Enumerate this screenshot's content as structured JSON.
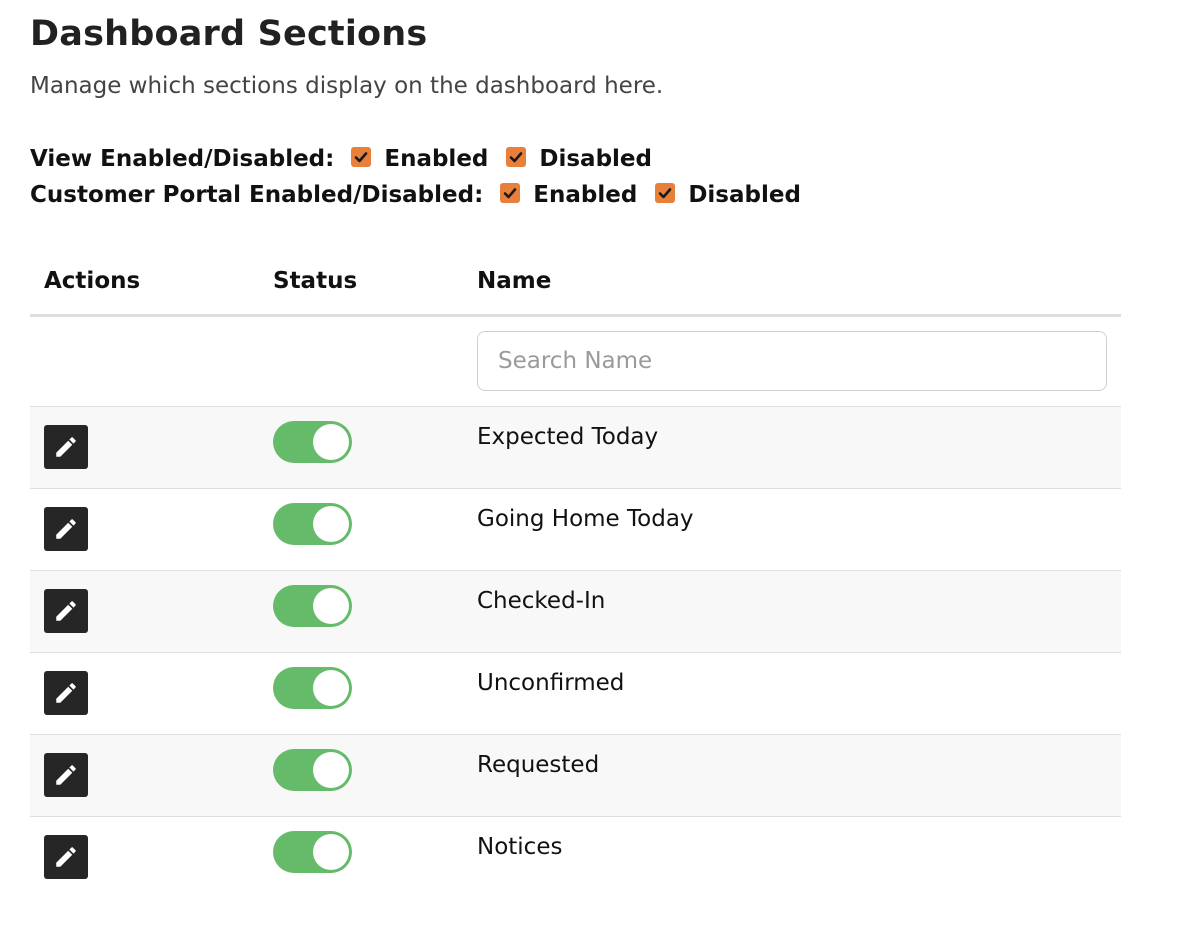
{
  "page": {
    "title": "Dashboard Sections",
    "subtitle": "Manage which sections display on the dashboard here."
  },
  "filters": [
    {
      "label": "View Enabled/Disabled:",
      "options": [
        {
          "label": "Enabled",
          "checked": true
        },
        {
          "label": "Disabled",
          "checked": true
        }
      ]
    },
    {
      "label": "Customer Portal Enabled/Disabled:",
      "options": [
        {
          "label": "Enabled",
          "checked": true
        },
        {
          "label": "Disabled",
          "checked": true
        }
      ]
    }
  ],
  "table": {
    "columns": [
      "Actions",
      "Status",
      "Name"
    ],
    "search": {
      "placeholder": "Search Name",
      "value": ""
    },
    "rows": [
      {
        "name": "Expected Today",
        "status": "on"
      },
      {
        "name": "Going Home Today",
        "status": "on"
      },
      {
        "name": "Checked-In",
        "status": "on"
      },
      {
        "name": "Unconfirmed",
        "status": "on"
      },
      {
        "name": "Requested",
        "status": "on"
      },
      {
        "name": "Notices",
        "status": "on"
      }
    ]
  },
  "icons": {
    "checkbox": "checkmark-icon",
    "edit": "pencil-icon"
  },
  "colors": {
    "checkbox_accent": "#e8803b",
    "toggle_on": "#66bb6a",
    "edit_button": "#262626",
    "row_stripe": "#f8f8f8"
  }
}
